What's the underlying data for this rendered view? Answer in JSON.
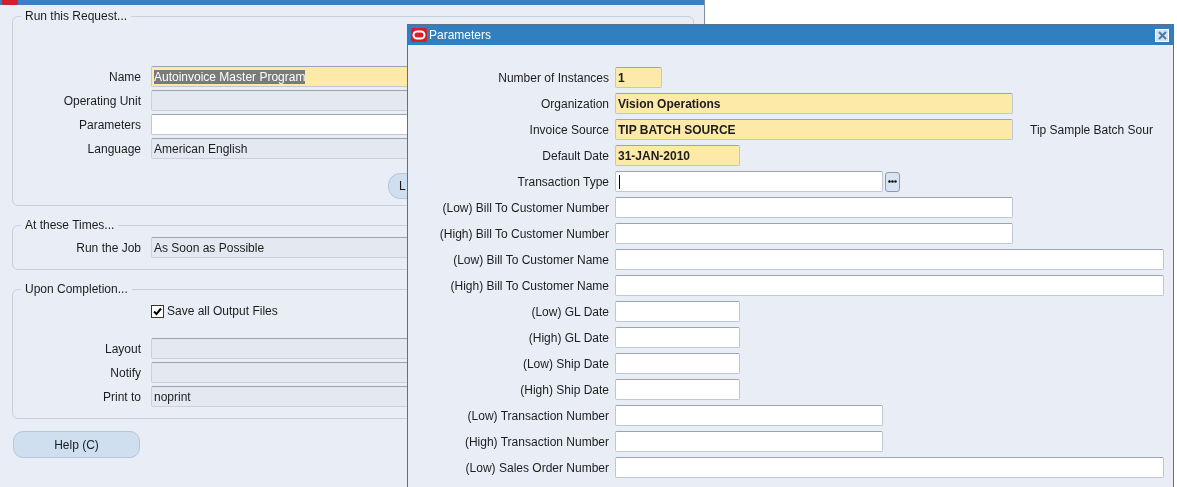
{
  "request_window": {
    "groups": [
      {
        "title": "Run this Request...",
        "items": [
          {
            "kind": "required_field",
            "label": "Name",
            "value": "Autoinvoice Master Program",
            "highlighted": true
          },
          {
            "kind": "readonly_field",
            "label": "Operating Unit"
          },
          {
            "kind": "text_field",
            "label": "Parameters"
          },
          {
            "kind": "readonly_field",
            "label": "Language",
            "value": "American English"
          },
          {
            "kind": "button",
            "label": "L"
          }
        ]
      },
      {
        "title": "At these Times...",
        "items": [
          {
            "kind": "readonly_field",
            "label": "Run the Job",
            "value": "As Soon as Possible"
          }
        ]
      },
      {
        "title": "Upon Completion...",
        "items": [
          {
            "kind": "checkbox",
            "label": "Save all Output Files",
            "checked": true
          },
          {
            "kind": "readonly_field",
            "label": "Layout"
          },
          {
            "kind": "readonly_field",
            "label": "Notify"
          },
          {
            "kind": "readonly_field",
            "label": "Print to",
            "value": "noprint"
          }
        ]
      }
    ],
    "help_button": "Help (C)"
  },
  "parameters_dialog": {
    "title": "Parameters",
    "rows": [
      {
        "kind": "required_field",
        "label": "Number of Instances",
        "value": "1"
      },
      {
        "kind": "required_field",
        "label": "Organization",
        "value": "Vision Operations"
      },
      {
        "kind": "required_field",
        "label": "Invoice Source",
        "value": "TIP BATCH SOURCE",
        "description": "Tip Sample Batch Sour"
      },
      {
        "kind": "required_field",
        "label": "Default Date",
        "value": "31-JAN-2010"
      },
      {
        "kind": "text_field",
        "label": "Transaction Type",
        "focused": true,
        "list_button": true
      },
      {
        "kind": "text_field",
        "label": "(Low) Bill To Customer Number"
      },
      {
        "kind": "text_field",
        "label": "(High) Bill To Customer Number"
      },
      {
        "kind": "text_field",
        "label": "(Low) Bill To Customer Name"
      },
      {
        "kind": "text_field",
        "label": "(High) Bill To Customer Name"
      },
      {
        "kind": "text_field",
        "label": "(Low) GL Date"
      },
      {
        "kind": "text_field",
        "label": "(High) GL Date"
      },
      {
        "kind": "text_field",
        "label": "(Low) Ship Date"
      },
      {
        "kind": "text_field",
        "label": "(High) Ship Date"
      },
      {
        "kind": "text_field",
        "label": "(Low) Transaction Number"
      },
      {
        "kind": "text_field",
        "label": "(High) Transaction  Number"
      },
      {
        "kind": "text_field",
        "label": "(Low) Sales Order Number"
      }
    ]
  }
}
